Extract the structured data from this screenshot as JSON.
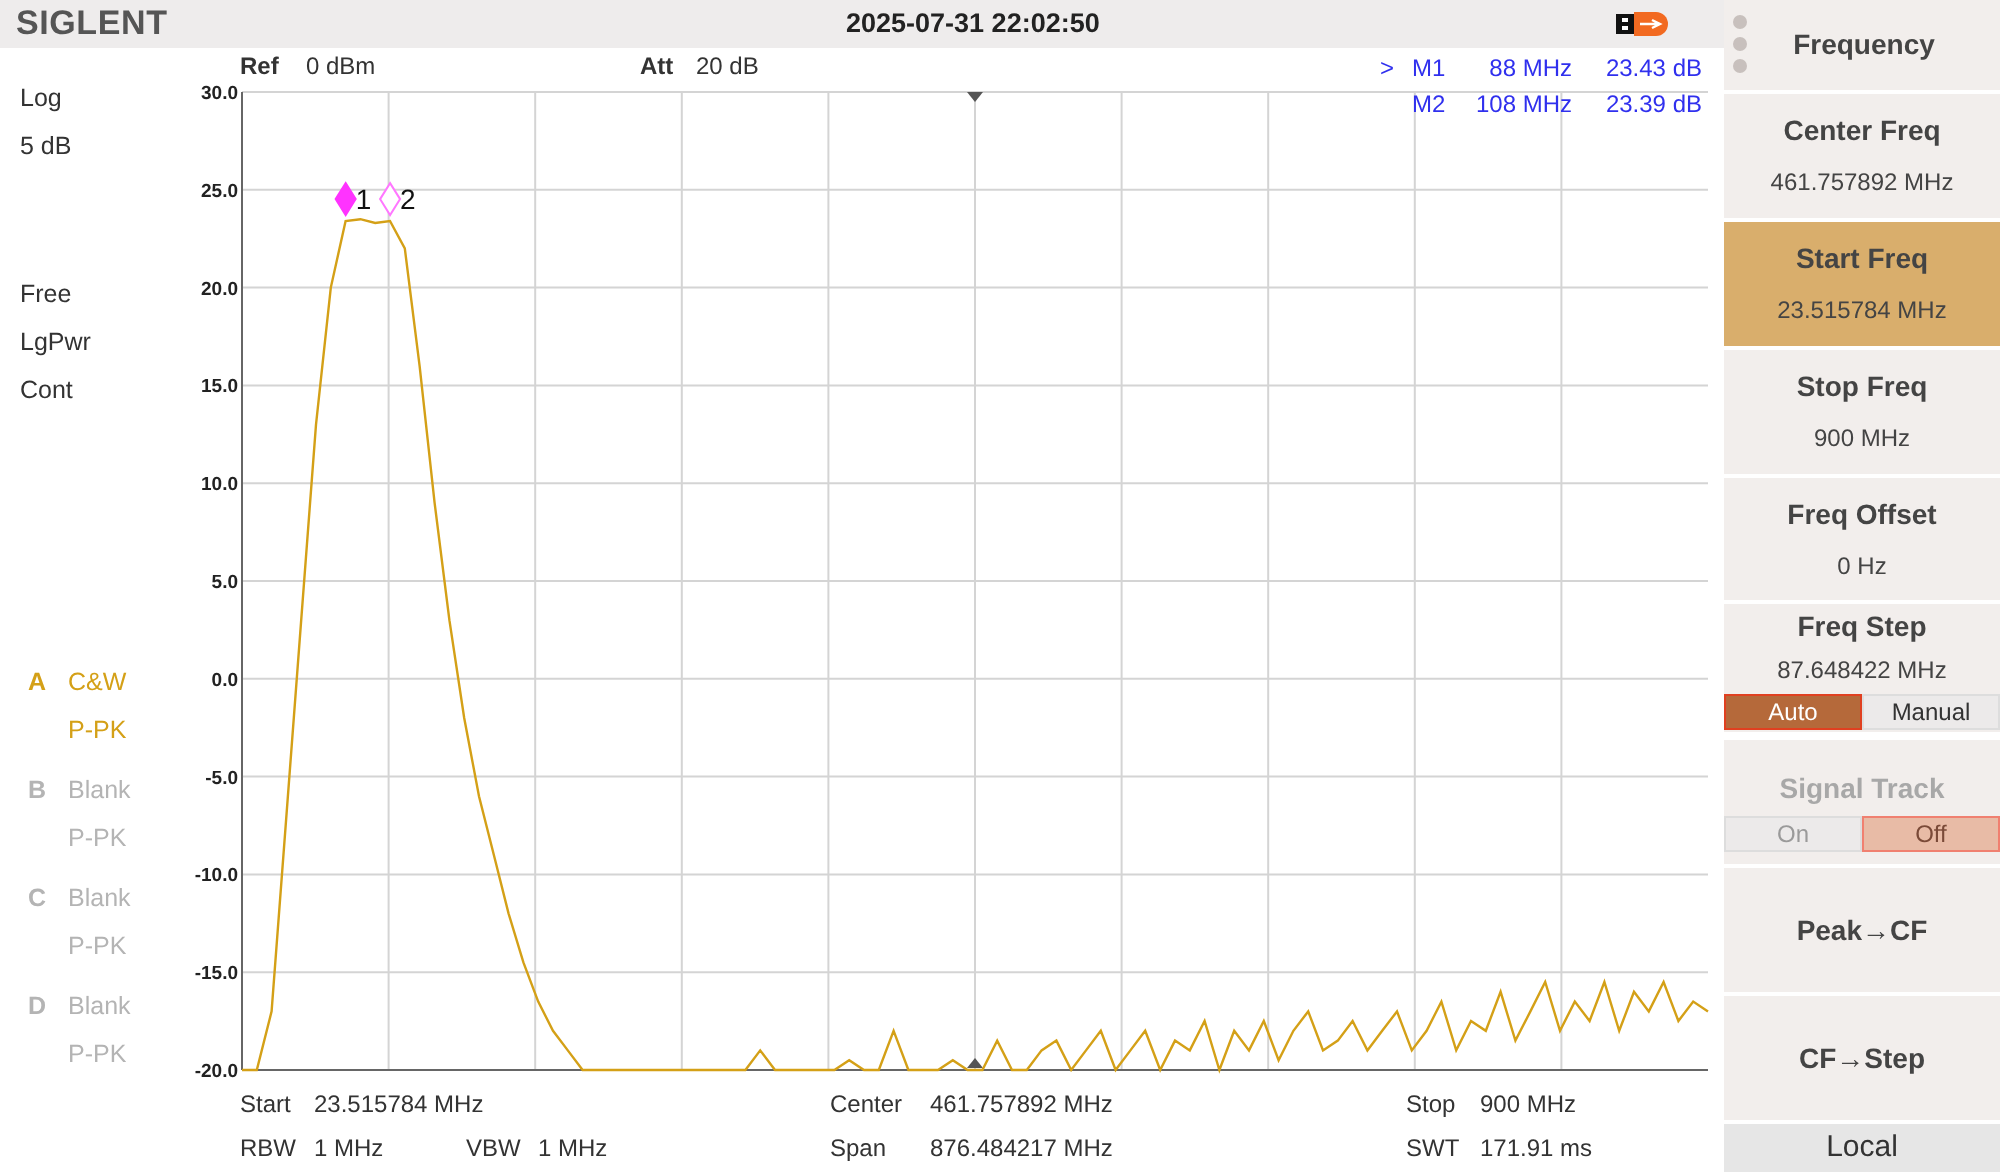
{
  "header": {
    "logo": "SIGLENT",
    "datetime": "2025-07-31 22:02:50"
  },
  "left_panel": {
    "scale_type": "Log",
    "scale_div": "5 dB",
    "trigger": "Free",
    "average": "LgPwr",
    "sweep": "Cont",
    "traces": [
      {
        "letter": "A",
        "type": "C&W",
        "detector": "P-PK",
        "disabled": false
      },
      {
        "letter": "B",
        "type": "Blank",
        "detector": "P-PK",
        "disabled": true
      },
      {
        "letter": "C",
        "type": "Blank",
        "detector": "P-PK",
        "disabled": true
      },
      {
        "letter": "D",
        "type": "Blank",
        "detector": "P-PK",
        "disabled": true
      }
    ]
  },
  "info_top": {
    "ref_label": "Ref",
    "ref_value": "0 dBm",
    "att_label": "Att",
    "att_value": "20 dB"
  },
  "marker_table": [
    {
      "pointer": ">",
      "name": "M1",
      "frequency": "88 MHz",
      "amplitude": "23.43 dB"
    },
    {
      "name": "M2",
      "frequency": "108 MHz",
      "amplitude": "23.39 dB"
    }
  ],
  "chart": {
    "chart_data": {
      "type": "line",
      "categories": [
        null,
        null,
        null,
        null,
        null,
        null,
        null,
        null,
        null,
        null,
        null,
        null,
        null,
        null,
        null,
        null,
        null,
        null,
        null,
        null,
        null,
        null,
        null,
        null,
        null,
        null,
        null,
        null,
        null,
        null,
        null,
        null,
        null,
        null,
        null,
        null,
        null,
        null,
        null,
        null,
        null,
        null,
        null,
        null,
        null,
        null,
        null,
        null,
        null,
        null,
        null,
        null,
        null,
        null,
        null,
        null,
        null,
        null,
        null,
        null,
        null,
        null,
        null,
        null,
        null,
        null,
        null,
        null,
        null,
        null,
        null,
        null,
        null,
        null,
        null,
        null,
        null,
        null,
        null,
        null,
        null,
        null,
        null,
        null,
        null,
        null,
        null,
        null,
        null,
        null,
        null,
        null,
        null,
        null,
        null,
        null,
        null,
        null,
        null,
        null
      ],
      "series": [
        {
          "color": "#d4a017",
          "values": [
            -20,
            -20,
            -17,
            -7,
            3,
            13,
            20,
            23.4,
            23.5,
            23.3,
            23.4,
            22,
            16,
            9,
            3,
            -2,
            -6,
            -9,
            -12,
            -14.5,
            -16.5,
            -18,
            -19,
            -20,
            -20,
            -20,
            -20,
            -20,
            -20,
            -20,
            -20,
            -20,
            -20,
            -20,
            -20,
            -19,
            -20,
            -20,
            -20,
            -20,
            -20,
            -19.5,
            -20,
            -20,
            -18,
            -20,
            -20,
            -20,
            -19.5,
            -20,
            -20,
            -18.5,
            -20,
            -20,
            -19,
            -18.5,
            -20,
            -19,
            -18,
            -20,
            -19,
            -18,
            -20,
            -18.5,
            -19,
            -17.5,
            -20,
            -18,
            -19,
            -17.5,
            -19.5,
            -18,
            -17,
            -19,
            -18.5,
            -17.5,
            -19,
            -18,
            -17,
            -19,
            -18,
            -16.5,
            -19,
            -17.5,
            -18,
            -16,
            -18.5,
            -17,
            -15.5,
            -18,
            -16.5,
            -17.5,
            -15.5,
            -18,
            -16,
            -17,
            -15.5,
            -17.5,
            -16.5,
            -17
          ]
        }
      ],
      "ylim": [
        -20,
        30
      ],
      "yticks": [
        {
          "value": 30,
          "label": "30.0"
        },
        {
          "value": 25,
          "label": "25.0"
        },
        {
          "value": 20,
          "label": "20.0"
        },
        {
          "value": 15,
          "label": "15.0"
        },
        {
          "value": 10,
          "label": "10.0"
        },
        {
          "value": 5,
          "label": "5.0"
        },
        {
          "value": 0,
          "label": "0.0"
        },
        {
          "value": -5,
          "label": "-5.0"
        },
        {
          "value": -10,
          "label": "-10.0"
        },
        {
          "value": -15,
          "label": "-15.0"
        },
        {
          "value": -20,
          "label": "-20.0"
        }
      ],
      "grid": true
    },
    "markers": [
      {
        "label": "1",
        "active": true
      },
      {
        "label": "2",
        "active": false
      }
    ]
  },
  "bottom_info": {
    "start": {
      "label": "Start",
      "value": "23.515784 MHz"
    },
    "rbw": {
      "label": "RBW",
      "value": "1 MHz"
    },
    "vbw": {
      "label": "VBW",
      "value": "1 MHz"
    },
    "center": {
      "label": "Center",
      "value": "461.757892 MHz"
    },
    "span": {
      "label": "Span",
      "value": "876.484217 MHz"
    },
    "stop": {
      "label": "Stop",
      "value": "900 MHz"
    },
    "swt": {
      "label": "SWT",
      "value": "171.91 ms"
    }
  },
  "softkeys": {
    "title": "Frequency",
    "keys": [
      {
        "kind": "value",
        "label": "Center Freq",
        "value": "461.757892 MHz",
        "selected": false
      },
      {
        "kind": "value",
        "label": "Start Freq",
        "value": "23.515784 MHz",
        "selected": true
      },
      {
        "kind": "value",
        "label": "Stop Freq",
        "value": "900 MHz",
        "selected": false
      },
      {
        "kind": "value",
        "label": "Freq Offset",
        "value": "0 Hz",
        "selected": false
      },
      {
        "kind": "toggle",
        "label": "Freq Step",
        "value": "87.648422 MHz",
        "selected": false,
        "disabled": false,
        "options": [
          {
            "label": "Auto",
            "selected": true
          },
          {
            "label": "Manual",
            "selected": false
          }
        ]
      },
      {
        "kind": "toggle",
        "label": "Signal Track",
        "selected": false,
        "disabled": true,
        "options": [
          {
            "label": "On",
            "selected": false
          },
          {
            "label": "Off",
            "selected": true
          }
        ]
      },
      {
        "kind": "action",
        "label": "Peak→CF",
        "selected": false
      },
      {
        "kind": "action",
        "label": "CF→Step",
        "selected": false
      }
    ]
  },
  "status": "Local"
}
